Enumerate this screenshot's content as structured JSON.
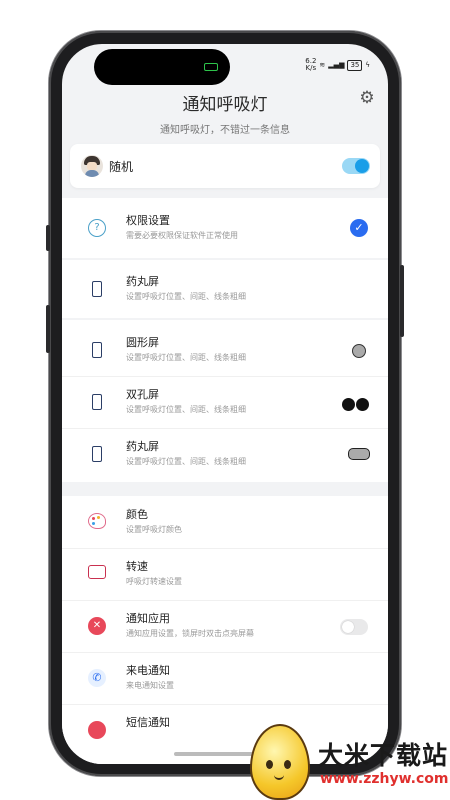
{
  "status_bar": {
    "net_speed_value": "6.2",
    "net_speed_unit": "K/s",
    "battery": "35"
  },
  "header": {
    "title": "通知呼吸灯",
    "subtitle": "通知呼吸灯，不错过一条信息"
  },
  "user": {
    "name": "随机",
    "toggle_on": true
  },
  "settings": [
    {
      "name": "权限设置",
      "desc": "需要必要权限保证软件正常使用",
      "icon": "question-icon",
      "indicator": "checked"
    },
    {
      "name": "药丸屏",
      "desc": "设置呼吸灯位置、间距、线条粗细",
      "icon": "phone-icon",
      "indicator": "none"
    },
    {
      "name": "圆形屏",
      "desc": "设置呼吸灯位置、间距、线条粗细",
      "icon": "phone-icon",
      "indicator": "circle"
    },
    {
      "name": "双孔屏",
      "desc": "设置呼吸灯位置、间距、线条粗细",
      "icon": "phone-icon",
      "indicator": "dual-hole"
    },
    {
      "name": "药丸屏",
      "desc": "设置呼吸灯位置、间距、线条粗细",
      "icon": "phone-icon",
      "indicator": "pill"
    },
    {
      "name": "颜色",
      "desc": "设置呼吸灯颜色",
      "icon": "palette-icon",
      "indicator": "none"
    },
    {
      "name": "转速",
      "desc": "呼吸灯转速设置",
      "icon": "speed-icon",
      "indicator": "none"
    },
    {
      "name": "通知应用",
      "desc": "通知应用设置，锁屏时双击点亮屏幕",
      "icon": "notification-app-icon",
      "indicator": "toggle-off"
    },
    {
      "name": "来电通知",
      "desc": "来电通知设置",
      "icon": "phone-call-icon",
      "indicator": "none"
    },
    {
      "name": "短信通知",
      "desc": "",
      "icon": "sms-icon",
      "indicator": "none"
    }
  ],
  "watermark": {
    "title": "大米下载站",
    "url": "www.zzhyw.com"
  },
  "colors": {
    "accent_blue": "#2a6cf0",
    "toggle_blue": "#1a9ee8",
    "watermark_red": "#e0302e"
  }
}
